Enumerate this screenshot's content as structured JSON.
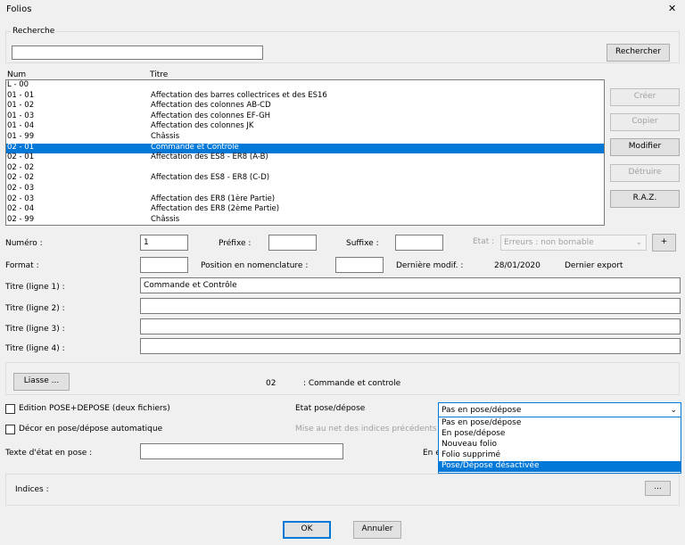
{
  "window": {
    "title": "Folios",
    "close": "✕"
  },
  "search": {
    "group_label": "Recherche",
    "value": "",
    "button": "Rechercher"
  },
  "list": {
    "headers": {
      "num": "Num",
      "titre": "Titre"
    },
    "rows": [
      {
        "num": "L - 00",
        "titre": ""
      },
      {
        "num": "01 - 01",
        "titre": "Affectation des barres collectrices et des ES16"
      },
      {
        "num": "01 - 02",
        "titre": "Affectation des colonnes AB-CD"
      },
      {
        "num": "01 - 03",
        "titre": "Affectation des colonnes EF-GH"
      },
      {
        "num": "01 - 04",
        "titre": "Affectation des colonnes JK"
      },
      {
        "num": "01 - 99",
        "titre": "Châssis"
      },
      {
        "num": "02 - 01",
        "titre": "Commande et Contrôle"
      },
      {
        "num": "02 - 01",
        "titre": "Affectation des ES8 - ER8 (A-B)"
      },
      {
        "num": "02 - 02",
        "titre": ""
      },
      {
        "num": "02 - 02",
        "titre": "Affectation des ES8 - ER8 (C-D)"
      },
      {
        "num": "02 - 03",
        "titre": ""
      },
      {
        "num": "02 - 03",
        "titre": "Affectation des ER8 (1ère Partie)"
      },
      {
        "num": "02 - 04",
        "titre": "Affectation des ER8 (2ème Partie)"
      },
      {
        "num": "02 - 99",
        "titre": "Châssis"
      }
    ]
  },
  "side_buttons": {
    "creer": "Créer",
    "copier": "Copier",
    "modifier": "Modifier",
    "detruire": "Détruire",
    "raz": "R.A.Z."
  },
  "form": {
    "numero_label": "Numéro :",
    "numero_value": "1",
    "prefixe_label": "Préfixe :",
    "prefixe_value": "",
    "suffixe_label": "Suffixe :",
    "suffixe_value": "",
    "etat_label": "Etat :",
    "etat_value": "Erreurs : non bornable",
    "plus": "+",
    "format_label": "Format :",
    "format_value": "",
    "position_label": "Position en nomenclature :",
    "position_value": "",
    "derniere_modif_label": "Dernière modif. :",
    "derniere_modif_value": "28/01/2020",
    "dernier_export_label": "Dernier export",
    "titre1_label": "Titre (ligne 1) :",
    "titre1_value": "Commande et Contrôle",
    "titre2_label": "Titre (ligne 2) :",
    "titre2_value": "",
    "titre3_label": "Titre (ligne 3) :",
    "titre3_value": "",
    "titre4_label": "Titre (ligne 4) :",
    "titre4_value": ""
  },
  "liasse": {
    "button": "Liasse ...",
    "num": "02",
    "name": ": Commande et controle"
  },
  "pose": {
    "edition_label": "Edition POSE+DEPOSE (deux fichiers)",
    "decor_label": "Décor en pose/dépose automatique",
    "etat_label": "Etat pose/dépose",
    "mise_label": "Mise au net des indices précédents",
    "texte_label": "Texte d'état en pose :",
    "texte_value": "",
    "en_label": "En é",
    "select_value": "Pas en pose/dépose",
    "options": [
      "Pas en pose/dépose",
      "En pose/dépose",
      "Nouveau folio",
      "Folio supprimé",
      "Pose/Dépose désactivée"
    ]
  },
  "indices": {
    "label": "Indices :",
    "button": "..."
  },
  "footer": {
    "ok": "OK",
    "annuler": "Annuler"
  }
}
